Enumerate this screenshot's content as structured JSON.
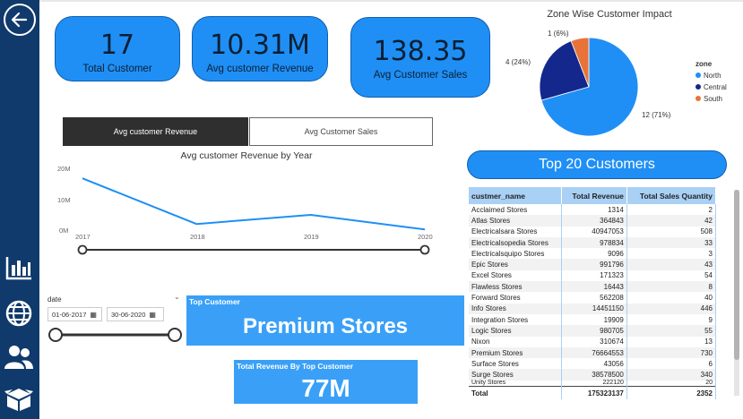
{
  "nav": {
    "back_icon": "back-arrow-icon",
    "icons": [
      "bar-chart-icon",
      "globe-icon",
      "users-icon",
      "box-icon"
    ]
  },
  "kpis": [
    {
      "value": "17",
      "label": "Total Customer"
    },
    {
      "value": "10.31M",
      "label": "Avg customer Revenue"
    },
    {
      "value": "138.35",
      "label": "Avg Customer Sales"
    }
  ],
  "tabs": {
    "active": "Avg customer Revenue",
    "inactive": "Avg Customer Sales"
  },
  "line_chart": {
    "title": "Avg customer Revenue by Year",
    "y_ticks": [
      "20M",
      "10M",
      "0M"
    ],
    "x_ticks": [
      "2017",
      "2018",
      "2019",
      "2020"
    ]
  },
  "date_slicer": {
    "label": "date",
    "start": "01-06-2017",
    "end": "30-06-2020"
  },
  "top_customer": {
    "title": "Top Customer",
    "value": "Premium Stores"
  },
  "top_revenue": {
    "title": "Total Revenue By Top Customer",
    "value": "77M"
  },
  "pie": {
    "title": "Zone Wise Customer Impact",
    "legend_title": "zone",
    "labels": [
      "12 (71%)",
      "4 (24%)",
      "1 (6%)"
    ]
  },
  "top20_title": "Top 20 Customers",
  "table": {
    "headers": [
      "custmer_name",
      "Total Revenue",
      "Total Sales Quantity"
    ],
    "rows": [
      [
        "Acclaimed Stores",
        "1314",
        "2"
      ],
      [
        "Atlas Stores",
        "364843",
        "42"
      ],
      [
        "Electricalsara Stores",
        "40947053",
        "508"
      ],
      [
        "Electricalsopedia Stores",
        "978834",
        "33"
      ],
      [
        "Electricalsquipo Stores",
        "9096",
        "3"
      ],
      [
        "Epic Stores",
        "991796",
        "43"
      ],
      [
        "Excel Stores",
        "171323",
        "54"
      ],
      [
        "Flawless Stores",
        "16443",
        "8"
      ],
      [
        "Forward Stores",
        "562208",
        "40"
      ],
      [
        "Info Stores",
        "14451150",
        "446"
      ],
      [
        "Integration Stores",
        "19909",
        "9"
      ],
      [
        "Logic Stores",
        "980705",
        "55"
      ],
      [
        "Nixon",
        "310674",
        "13"
      ],
      [
        "Premium Stores",
        "76664553",
        "730"
      ],
      [
        "Surface Stores",
        "43056",
        "6"
      ],
      [
        "Surge Stores",
        "38578500",
        "340"
      ],
      [
        "Unity Stores",
        "222120",
        "20"
      ]
    ],
    "total": [
      "Total",
      "175323137",
      "2352"
    ]
  },
  "chart_data": [
    {
      "type": "line",
      "title": "Avg customer Revenue by Year",
      "x": [
        "2017",
        "2018",
        "2019",
        "2020"
      ],
      "values": [
        17,
        2,
        5,
        0.2
      ],
      "unit": "M",
      "ylim": [
        0,
        20
      ],
      "color": "#1f8ff5"
    },
    {
      "type": "pie",
      "title": "Zone Wise Customer Impact",
      "categories": [
        "North",
        "Central",
        "South"
      ],
      "values": [
        12,
        4,
        1
      ],
      "percent": [
        71,
        24,
        6
      ],
      "colors": [
        "#1f8ff5",
        "#13278c",
        "#e8733a"
      ],
      "legend_position": "right"
    }
  ]
}
